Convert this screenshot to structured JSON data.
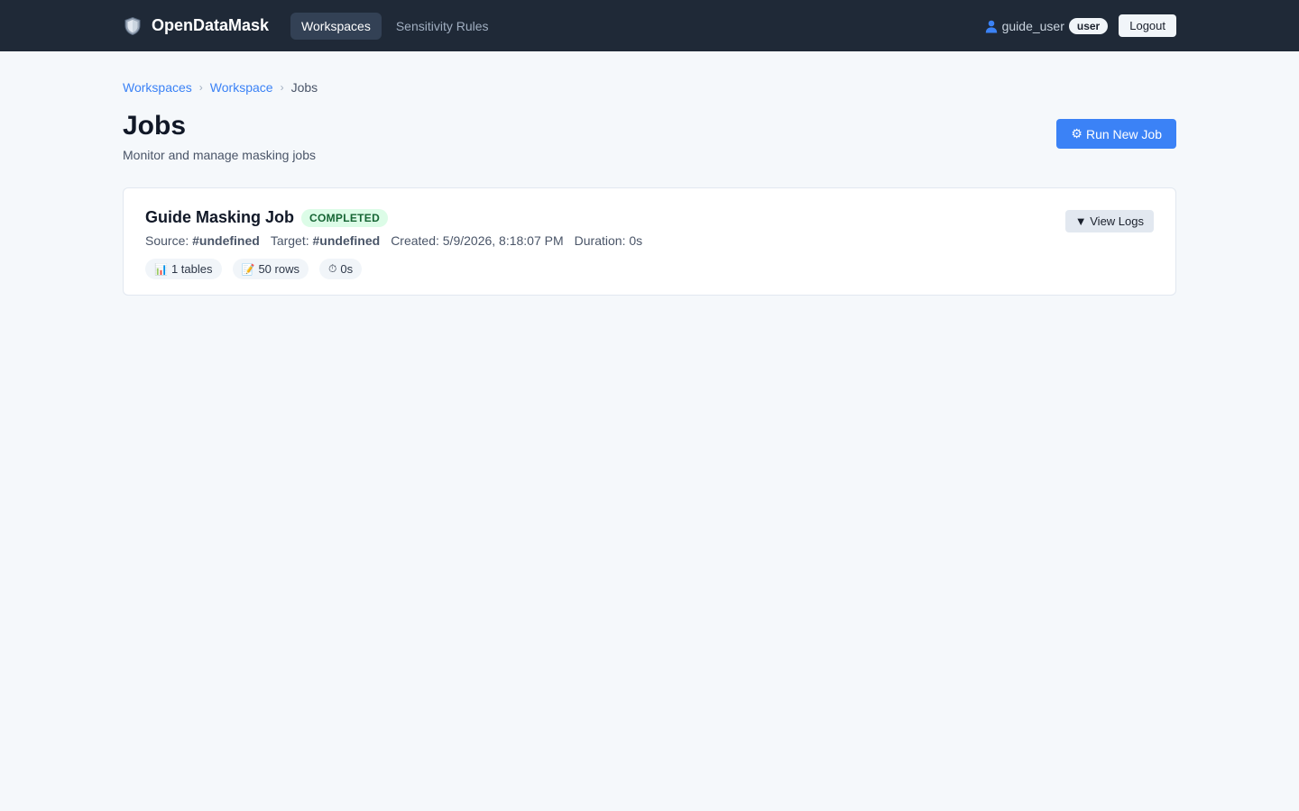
{
  "nav": {
    "brand": "OpenDataMask",
    "links": [
      {
        "label": "Workspaces",
        "active": true
      },
      {
        "label": "Sensitivity Rules",
        "active": false
      }
    ],
    "user": {
      "username": "guide_user",
      "role": "user"
    },
    "logout_label": "Logout"
  },
  "breadcrumb": {
    "items": [
      "Workspaces",
      "Workspace"
    ],
    "current": "Jobs",
    "separator": "›"
  },
  "header": {
    "title": "Jobs",
    "subtitle": "Monitor and manage masking jobs",
    "run_button_icon": "⚙",
    "run_button_label": "Run New Job"
  },
  "jobs": [
    {
      "name": "Guide Masking Job",
      "status": "COMPLETED",
      "source_label": "Source:",
      "source_value": "#undefined",
      "target_label": "Target:",
      "target_value": "#undefined",
      "created": "Created: 5/9/2026, 8:18:07 PM",
      "duration": "Duration: 0s",
      "chips": [
        {
          "icon": "📊",
          "label": "1 tables"
        },
        {
          "icon": "📝",
          "label": "50 rows"
        },
        {
          "icon": "⏱",
          "label": "0s"
        }
      ],
      "logs_label": "▼ View Logs"
    }
  ],
  "colors": {
    "nav_bg": "#1f2937",
    "accent": "#3b82f6",
    "page_bg": "#f5f8fb",
    "status_completed_bg": "#dcfce7",
    "status_completed_fg": "#166534"
  }
}
